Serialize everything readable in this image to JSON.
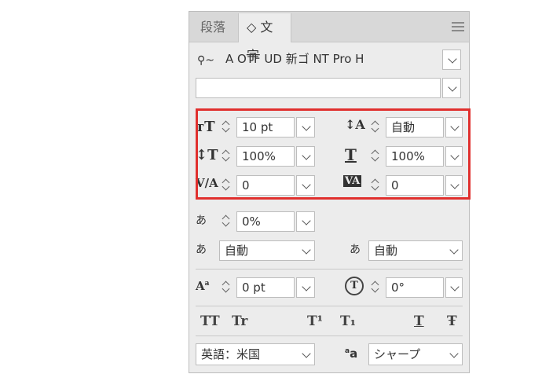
{
  "tabs": [
    {
      "label": "段落",
      "active": false
    },
    {
      "label": "◇ 文字",
      "active": true
    }
  ],
  "font": {
    "family": "A OTF UD 新ゴ NT Pro H",
    "style": ""
  },
  "settings": {
    "font_size": "10 pt",
    "leading": "自動",
    "vertical_scale": "100%",
    "horizontal_scale": "100%",
    "kerning": "0",
    "tracking": "0",
    "tsume": "0%",
    "mojikumi_before": "自動",
    "mojikumi_after": "自動",
    "baseline_shift": "0 pt",
    "rotation": "0°"
  },
  "styles": [
    "TT",
    "Tr",
    "T¹",
    "T₁",
    "T",
    "Ŧ"
  ],
  "language": "英語：米国",
  "antialias": "シャープ",
  "highlight_color": "#e0302e"
}
